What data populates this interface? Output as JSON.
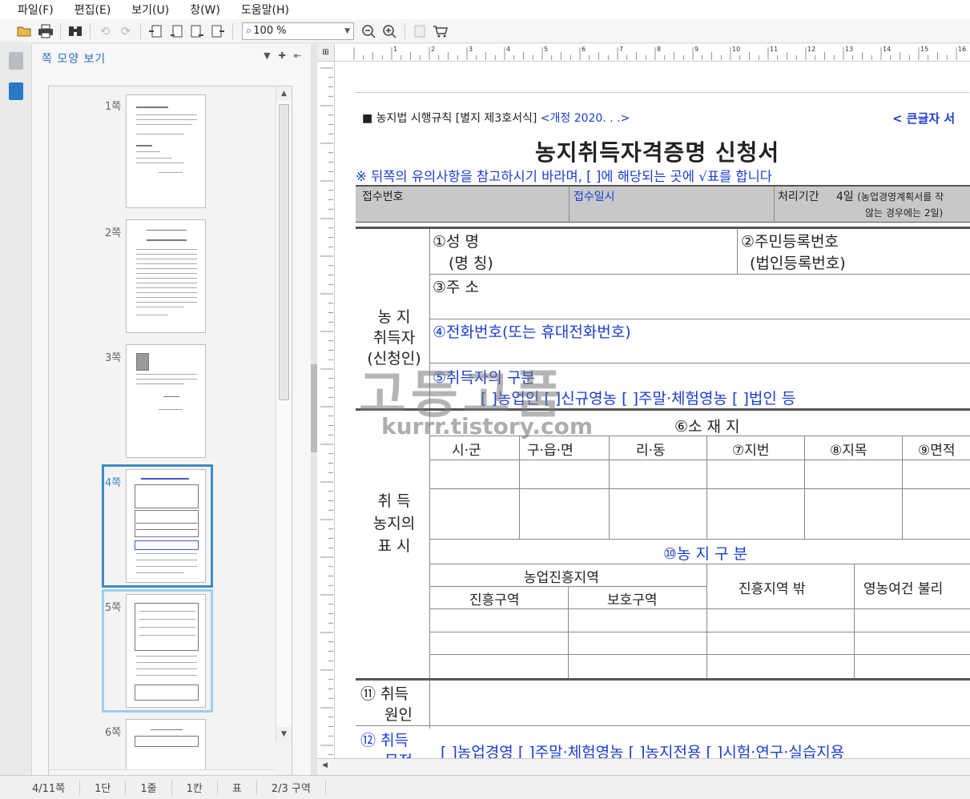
{
  "menu": [
    "파일(F)",
    "편집(E)",
    "보기(U)",
    "창(W)",
    "도움말(H)"
  ],
  "toolbar": {
    "icons": [
      "folder-open-icon",
      "print-icon",
      "binoculars-icon",
      "undo-icon",
      "redo-icon",
      "page-first-icon",
      "page-prev-icon",
      "page-next-icon",
      "page-last-icon",
      "zoom-out-icon",
      "zoom-in-icon",
      "book-icon",
      "cart-icon"
    ],
    "zoom_value": "100 %"
  },
  "panel": {
    "title": "쪽 모양 보기",
    "pages": [
      "1쪽",
      "2쪽",
      "3쪽",
      "4쪽",
      "5쪽",
      "6쪽"
    ]
  },
  "document": {
    "header_left": "■  농지법 시행규칙 [별지 제3호서식]",
    "header_rev": "<개정 2020.  .  .>",
    "header_right": "< 큰글자 서",
    "title": "농지취득자격증명 신청서",
    "notice": "※ 뒤쪽의 유의사항을 참고하시기 바라며, [  ]에 해당되는 곳에 √표를 합니다",
    "receipt_no": "접수번호",
    "receipt_date": "접수일시",
    "proc_period": "처리기간",
    "proc_days": "4일",
    "proc_note1": "(농업경영계획서를 작",
    "proc_note2": "않는 경우에는 2일)",
    "applicant_group": [
      "농  지",
      "취득자",
      "(신청인)"
    ],
    "f1a": "①성 명",
    "f1b": "(명 칭)",
    "f2a": "②주민등록번호",
    "f2b": "(법인등록번호)",
    "f3": "③주 소",
    "f4": "④전화번호(또는 휴대전화번호)",
    "f5": "⑤취득자의 구분",
    "f5_opts": "[  ]농업인   [  ]신규영농   [  ]주말·체험영농   [  ]법인 등",
    "land_group": [
      "취  득",
      "농지의",
      "표  시"
    ],
    "f6": "⑥소 재 지",
    "col_sigun": "시·군",
    "col_gueup": "구·읍·면",
    "col_ridong": "리·동",
    "f7": "⑦지번",
    "f8": "⑧지목",
    "f9": "⑨면적",
    "f10": "⑩농 지 구 분",
    "agri_zone": "농업진흥지역",
    "promo_zone": "진흥구역",
    "protect_zone": "보호구역",
    "outside_zone": "진흥지역 밖",
    "bad_cond": "영농여건 불리",
    "f11_num": "⑪",
    "f11a": "취득",
    "f11b": "원인",
    "f12_num": "⑫",
    "f12a": "취득",
    "f12b": "목적",
    "f12_opts": "[  ]농업경영   [  ]주말·체험영농   [  ]농지전용   [  ]시험·연구·실습지용",
    "watermark1": "고등고품",
    "watermark2": "kurrr.tistory.com"
  },
  "ruler_ticks": [
    "1",
    "2",
    "3",
    "4",
    "5",
    "6",
    "7",
    "8",
    "9",
    "10",
    "11",
    "12",
    "13",
    "14",
    "15",
    "16"
  ],
  "status": [
    "4/11쪽",
    "1단",
    "1줄",
    "1칸",
    "표",
    "2/3 구역"
  ]
}
